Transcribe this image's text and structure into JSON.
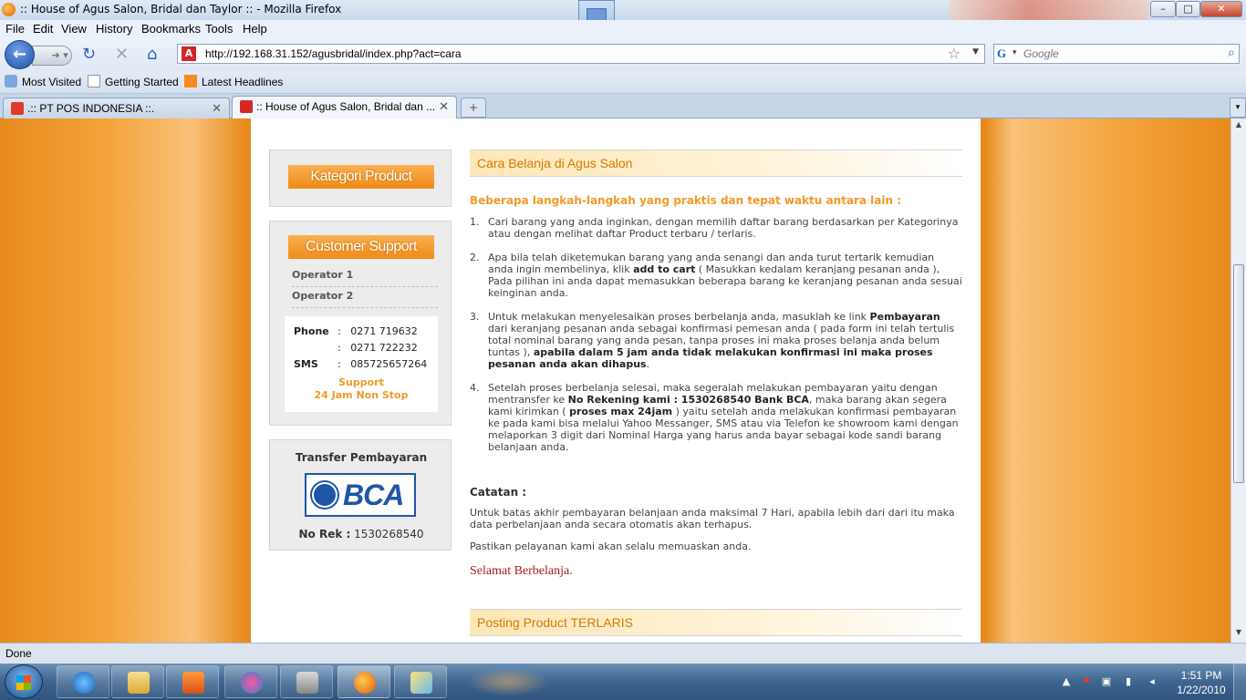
{
  "window": {
    "title": ":: House of Agus Salon, Bridal dan Taylor :: - Mozilla Firefox",
    "minimize": "–",
    "maximize": "□",
    "close": "✕"
  },
  "menu": [
    "File",
    "Edit",
    "View",
    "History",
    "Bookmarks",
    "Tools",
    "Help"
  ],
  "nav": {
    "url": "http://192.168.31.152/agusbridal/index.php?act=cara",
    "search_placeholder": "Google",
    "site_icon": "A"
  },
  "bookmarks": [
    "Most Visited",
    "Getting Started",
    "Latest Headlines"
  ],
  "tabs": [
    {
      "label": ".:: PT POS INDONESIA ::.",
      "active": false
    },
    {
      "label": ":: House of Agus Salon, Bridal dan ...",
      "active": true
    }
  ],
  "sidebar": {
    "kategori_banner": "Kategori Product",
    "support_banner": "Customer Support",
    "operators": [
      "Operator 1",
      "Operator 2"
    ],
    "contact": {
      "phone_label": "Phone",
      "phone1": "0271 719632",
      "phone2": "0271 722232",
      "sms_label": "SMS",
      "sms": "085725657264",
      "sep": ":",
      "support_line1": "Support",
      "support_line2": "24 Jam Non Stop"
    },
    "transfer_title": "Transfer Pembayaran",
    "bank_logo_text": "BCA",
    "norek_label": "No Rek :",
    "norek_value": "1530268540"
  },
  "main": {
    "header": "Cara Belanja di Agus Salon",
    "lead": "Beberapa langkah-langkah yang praktis dan tepat waktu antara lain :",
    "steps": [
      {
        "n": "1.",
        "text": "Cari barang yang anda inginkan, dengan memilih daftar barang berdasarkan per Kategorinya atau dengan melihat daftar Product terbaru / terlaris."
      },
      {
        "n": "2.",
        "a": "Apa bila telah diketemukan barang yang anda senangi dan anda turut tertarik kemudian anda ingin membelinya, klik ",
        "b": "add to cart",
        "c": " ( Masukkan kedalam keranjang pesanan anda ), Pada pilihan ini anda dapat memasukkan beberapa barang ke keranjang pesanan anda sesuai keinginan anda."
      },
      {
        "n": "3.",
        "a": "Untuk melakukan menyelesaikan proses berbelanja anda, masuklah ke link ",
        "b": "Pembayaran",
        "c": " dari keranjang pesanan anda sebagai konfirmasi pemesan anda ( pada form ini telah tertulis total nominal barang yang anda pesan, tanpa proses ini maka proses belanja anda belum tuntas ), ",
        "d": "apabila dalam 5 jam anda tidak melakukan konfirmasi ini maka proses pesanan anda akan dihapus",
        "e": "."
      },
      {
        "n": "4.",
        "a": "Setelah proses berbelanja selesai, maka segeralah melakukan pembayaran yaitu dengan mentransfer ke ",
        "b": "No Rekening kami : 1530268540 Bank BCA",
        "c": ", maka barang akan segera kami kirimkan ( ",
        "d": "proses max 24jam",
        "e": " ) yaitu setelah anda melakukan konfirmasi pembayaran ke pada kami bisa melalui Yahoo Messanger, SMS atau via Telefon ke showroom kami dengan melaporkan 3 digit dari Nominal Harga yang harus anda bayar sebagai kode sandi barang belanjaan anda."
      }
    ],
    "catatan_title": "Catatan :",
    "catatan_p1": "Untuk batas akhir pembayaran belanjaan anda maksimal 7 Hari, apabila lebih dari dari itu maka data perbelanjaan anda secara otomatis akan terhapus.",
    "catatan_p2": "Pastikan pelayanan kami akan selalu memuaskan anda.",
    "closing": "Selamat Berbelanja.",
    "header2": "Posting Product TERLARIS"
  },
  "status": "Done",
  "taskbar": {
    "time": "1:51 PM",
    "date": "1/22/2010"
  }
}
